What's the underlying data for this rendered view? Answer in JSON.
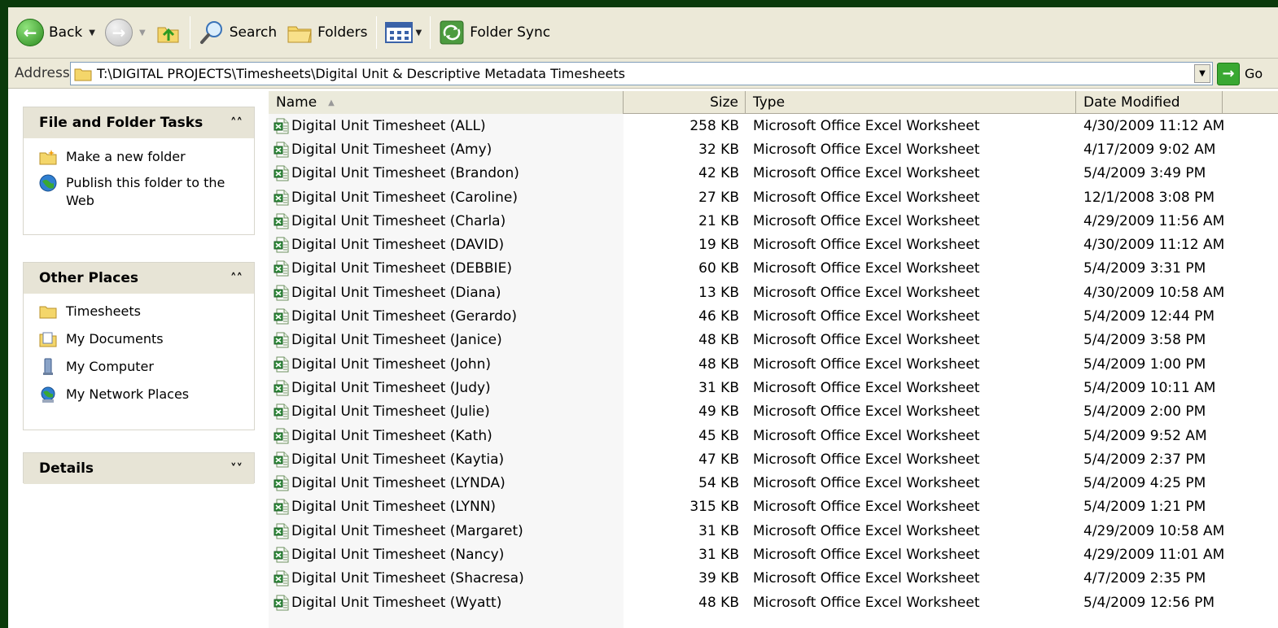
{
  "toolbar": {
    "back_label": "Back",
    "search_label": "Search",
    "folders_label": "Folders",
    "folder_sync_label": "Folder Sync"
  },
  "address": {
    "label": "Address",
    "path": "T:\\DIGITAL PROJECTS\\Timesheets\\Digital Unit & Descriptive Metadata Timesheets",
    "go_label": "Go"
  },
  "tasks_panel": {
    "title": "File and Folder Tasks",
    "items": [
      {
        "label": "Make a new folder",
        "icon": "new-folder-icon"
      },
      {
        "label": "Publish this folder to the Web",
        "icon": "publish-web-icon"
      }
    ]
  },
  "places_panel": {
    "title": "Other Places",
    "items": [
      {
        "label": "Timesheets",
        "icon": "folder-icon"
      },
      {
        "label": "My Documents",
        "icon": "my-documents-icon"
      },
      {
        "label": "My Computer",
        "icon": "my-computer-icon"
      },
      {
        "label": "My Network Places",
        "icon": "network-places-icon"
      }
    ]
  },
  "details_panel": {
    "title": "Details"
  },
  "columns": {
    "name": "Name",
    "size": "Size",
    "type": "Type",
    "date": "Date Modified"
  },
  "files": [
    {
      "name": "Digital Unit Timesheet (ALL)",
      "size": "258 KB",
      "type": "Microsoft Office Excel Worksheet",
      "date": "4/30/2009 11:12 AM"
    },
    {
      "name": "Digital Unit Timesheet (Amy)",
      "size": "32 KB",
      "type": "Microsoft Office Excel Worksheet",
      "date": "4/17/2009 9:02 AM"
    },
    {
      "name": "Digital Unit Timesheet (Brandon)",
      "size": "42 KB",
      "type": "Microsoft Office Excel Worksheet",
      "date": "5/4/2009 3:49 PM"
    },
    {
      "name": "Digital Unit Timesheet (Caroline)",
      "size": "27 KB",
      "type": "Microsoft Office Excel Worksheet",
      "date": "12/1/2008 3:08 PM"
    },
    {
      "name": "Digital Unit Timesheet (Charla)",
      "size": "21 KB",
      "type": "Microsoft Office Excel Worksheet",
      "date": "4/29/2009 11:56 AM"
    },
    {
      "name": "Digital Unit Timesheet (DAVID)",
      "size": "19 KB",
      "type": "Microsoft Office Excel Worksheet",
      "date": "4/30/2009 11:12 AM"
    },
    {
      "name": "Digital Unit Timesheet (DEBBIE)",
      "size": "60 KB",
      "type": "Microsoft Office Excel Worksheet",
      "date": "5/4/2009 3:31 PM"
    },
    {
      "name": "Digital Unit Timesheet (Diana)",
      "size": "13 KB",
      "type": "Microsoft Office Excel Worksheet",
      "date": "4/30/2009 10:58 AM"
    },
    {
      "name": "Digital Unit Timesheet (Gerardo)",
      "size": "46 KB",
      "type": "Microsoft Office Excel Worksheet",
      "date": "5/4/2009 12:44 PM"
    },
    {
      "name": "Digital Unit Timesheet (Janice)",
      "size": "48 KB",
      "type": "Microsoft Office Excel Worksheet",
      "date": "5/4/2009 3:58 PM"
    },
    {
      "name": "Digital Unit Timesheet (John)",
      "size": "48 KB",
      "type": "Microsoft Office Excel Worksheet",
      "date": "5/4/2009 1:00 PM"
    },
    {
      "name": "Digital Unit Timesheet (Judy)",
      "size": "31 KB",
      "type": "Microsoft Office Excel Worksheet",
      "date": "5/4/2009 10:11 AM"
    },
    {
      "name": "Digital Unit Timesheet (Julie)",
      "size": "49 KB",
      "type": "Microsoft Office Excel Worksheet",
      "date": "5/4/2009 2:00 PM"
    },
    {
      "name": "Digital Unit Timesheet (Kath)",
      "size": "45 KB",
      "type": "Microsoft Office Excel Worksheet",
      "date": "5/4/2009 9:52 AM"
    },
    {
      "name": "Digital Unit Timesheet (Kaytia)",
      "size": "47 KB",
      "type": "Microsoft Office Excel Worksheet",
      "date": "5/4/2009 2:37 PM"
    },
    {
      "name": "Digital Unit Timesheet (LYNDA)",
      "size": "54 KB",
      "type": "Microsoft Office Excel Worksheet",
      "date": "5/4/2009 4:25 PM"
    },
    {
      "name": "Digital Unit Timesheet (LYNN)",
      "size": "315 KB",
      "type": "Microsoft Office Excel Worksheet",
      "date": "5/4/2009 1:21 PM"
    },
    {
      "name": "Digital Unit Timesheet (Margaret)",
      "size": "31 KB",
      "type": "Microsoft Office Excel Worksheet",
      "date": "4/29/2009 10:58 AM"
    },
    {
      "name": "Digital Unit Timesheet (Nancy)",
      "size": "31 KB",
      "type": "Microsoft Office Excel Worksheet",
      "date": "4/29/2009 11:01 AM"
    },
    {
      "name": "Digital Unit Timesheet (Shacresa)",
      "size": "39 KB",
      "type": "Microsoft Office Excel Worksheet",
      "date": "4/7/2009 2:35 PM"
    },
    {
      "name": "Digital Unit Timesheet (Wyatt)",
      "size": "48 KB",
      "type": "Microsoft Office Excel Worksheet",
      "date": "5/4/2009 12:56 PM"
    }
  ],
  "colors": {
    "desktop_bg": "#0b3a0b",
    "chrome": "#ece9d8",
    "panel_head": "#e7e4d6"
  }
}
